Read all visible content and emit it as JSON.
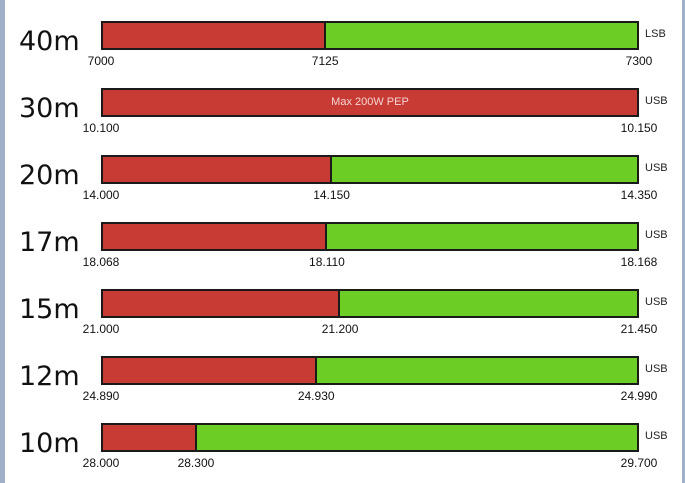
{
  "chart_data": {
    "type": "bar",
    "colors": {
      "restricted": "#c83a34",
      "open": "#6cce24"
    },
    "bands": [
      {
        "label": "40m",
        "mode": "LSB",
        "start": 7000,
        "split": 7125,
        "end": 7300,
        "tick_labels": [
          "7000",
          "7125",
          "7300"
        ]
      },
      {
        "label": "30m",
        "mode": "USB",
        "start": 10.1,
        "split": null,
        "end": 10.15,
        "note": "Max 200W PEP",
        "tick_labels": [
          "10.100",
          "10.150"
        ]
      },
      {
        "label": "20m",
        "mode": "USB",
        "start": 14.0,
        "split": 14.15,
        "end": 14.35,
        "tick_labels": [
          "14.000",
          "14.150",
          "14.350"
        ]
      },
      {
        "label": "17m",
        "mode": "USB",
        "start": 18.068,
        "split": 18.11,
        "end": 18.168,
        "tick_labels": [
          "18.068",
          "18.110",
          "18.168"
        ]
      },
      {
        "label": "15m",
        "mode": "USB",
        "start": 21.0,
        "split": 21.2,
        "end": 21.45,
        "tick_labels": [
          "21.000",
          "21.200",
          "21.450"
        ]
      },
      {
        "label": "12m",
        "mode": "USB",
        "start": 24.89,
        "split": 24.93,
        "end": 24.99,
        "tick_labels": [
          "24.890",
          "24.930",
          "24.990"
        ]
      },
      {
        "label": "10m",
        "mode": "USB",
        "start": 28.0,
        "split": 28.3,
        "end": 29.7,
        "tick_labels": [
          "28.000",
          "28.300",
          "29.700"
        ]
      }
    ]
  }
}
